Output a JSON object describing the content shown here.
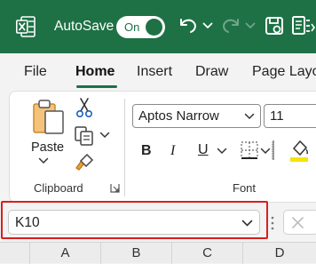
{
  "titlebar": {
    "autosave_label": "AutoSave",
    "toggle_state": "On",
    "icons": [
      "excel-logo-icon",
      "undo-icon",
      "dropdown-icon",
      "redo-icon",
      "save-icon",
      "overflow-icon"
    ]
  },
  "tabs": [
    {
      "label": "File"
    },
    {
      "label": "Home"
    },
    {
      "label": "Insert"
    },
    {
      "label": "Draw"
    },
    {
      "label": "Page Layo"
    }
  ],
  "active_tab": "Home",
  "ribbon": {
    "clipboard": {
      "paste_label": "Paste",
      "group_label": "Clipboard"
    },
    "font": {
      "font_name": "Aptos Narrow",
      "font_size": "11",
      "bold": "B",
      "italic": "I",
      "underline": "U",
      "group_label": "Font"
    }
  },
  "name_box": {
    "value": "K10"
  },
  "column_headers": [
    "A",
    "B",
    "C",
    "D"
  ],
  "colors": {
    "brand_green": "#1e7145",
    "highlight_red": "#d81f1f",
    "fill_yellow": "#f5e400"
  }
}
